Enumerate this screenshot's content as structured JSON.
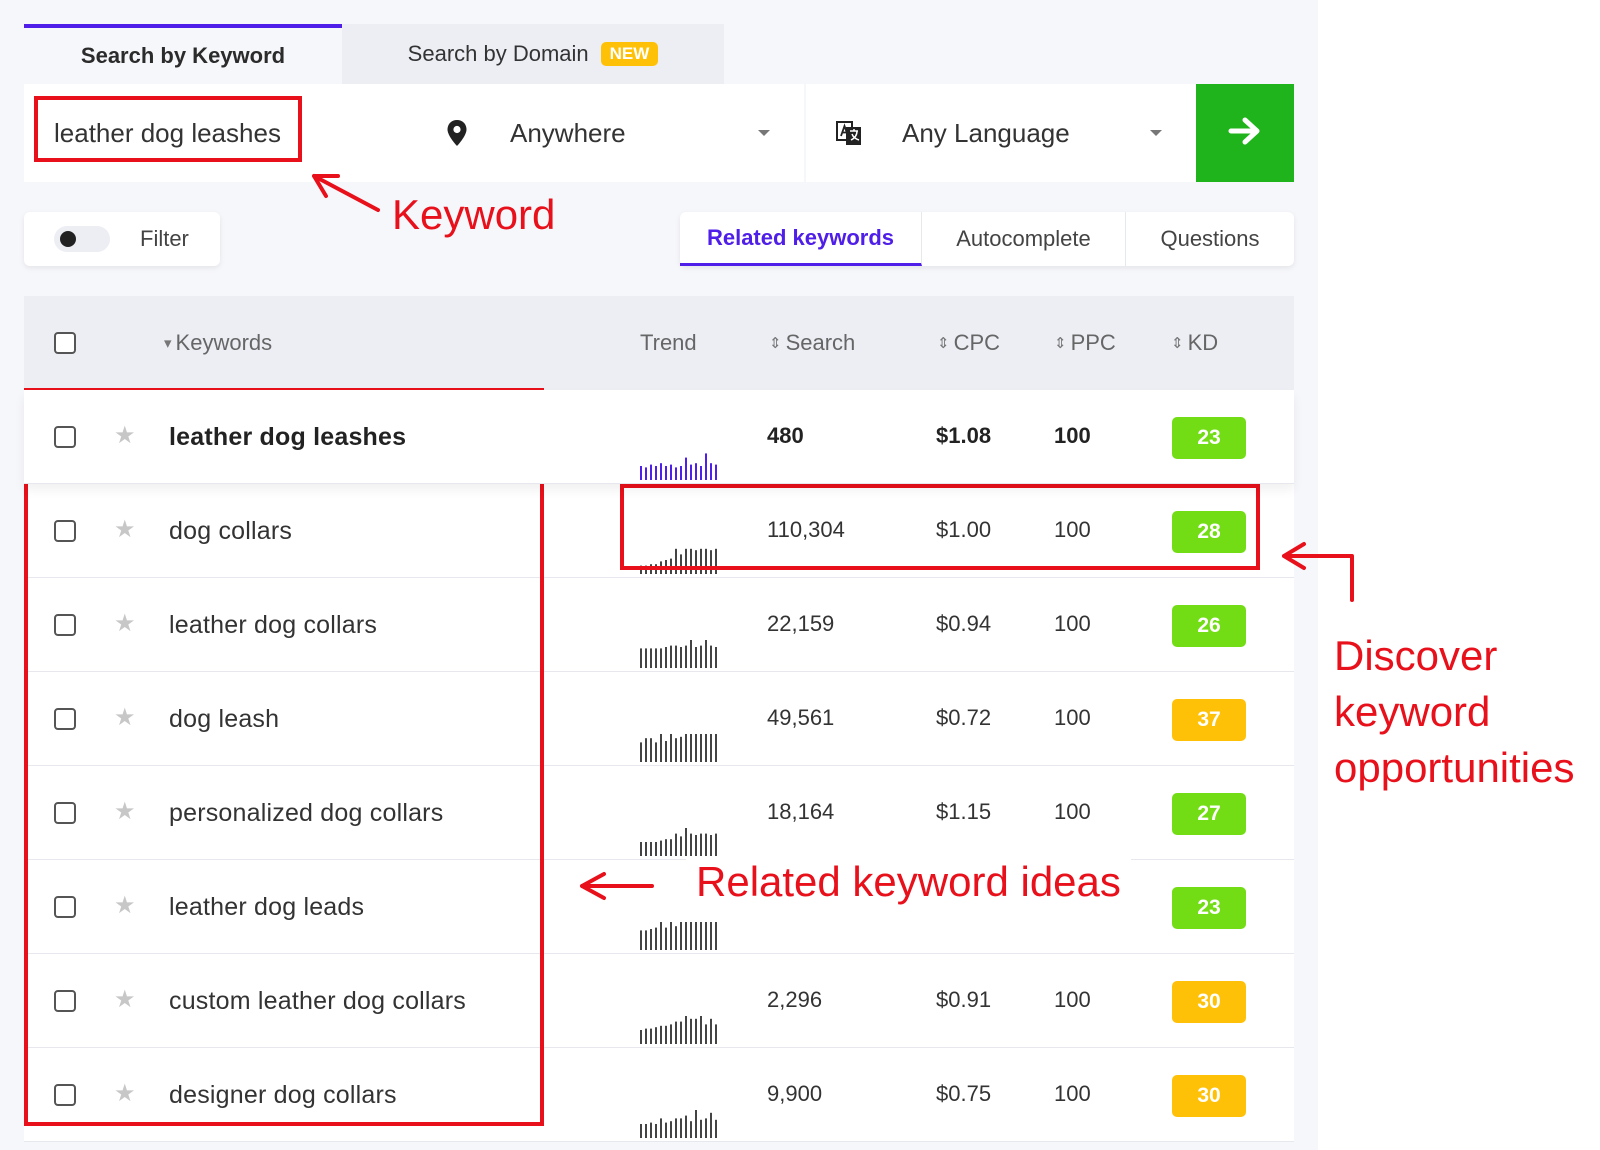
{
  "tabs": {
    "keyword": "Search by Keyword",
    "domain": "Search by Domain",
    "new_badge": "NEW"
  },
  "search": {
    "keyword_value": "leather dog leashes",
    "location": "Anywhere",
    "language": "Any Language"
  },
  "filter": {
    "label": "Filter"
  },
  "subtabs": [
    "Related keywords",
    "Autocomplete",
    "Questions"
  ],
  "columns": {
    "keywords": "Keywords",
    "trend": "Trend",
    "search": "Search",
    "cpc": "CPC",
    "ppc": "PPC",
    "kd": "KD"
  },
  "rows": [
    {
      "keyword": "leather dog leashes",
      "search": "480",
      "cpc": "$1.08",
      "ppc": "100",
      "kd": "23",
      "kd_color": "#72dd14",
      "trend_color": "#4f1ee8",
      "trend": [
        0.5,
        0.45,
        0.55,
        0.5,
        0.6,
        0.5,
        0.55,
        0.45,
        0.5,
        0.8,
        0.55,
        0.6,
        0.5,
        0.95,
        0.6,
        0.55
      ]
    },
    {
      "keyword": "dog collars",
      "search": "110,304",
      "cpc": "$1.00",
      "ppc": "100",
      "kd": "28",
      "kd_color": "#72dd14",
      "trend_color": "#444444",
      "trend": [
        0.3,
        0.3,
        0.35,
        0.35,
        0.45,
        0.5,
        0.55,
        0.9,
        0.7,
        0.9,
        0.9,
        0.85,
        0.9,
        0.9,
        0.85,
        0.9
      ]
    },
    {
      "keyword": "leather dog collars",
      "search": "22,159",
      "cpc": "$0.94",
      "ppc": "100",
      "kd": "26",
      "kd_color": "#72dd14",
      "trend_color": "#444444",
      "trend": [
        0.7,
        0.7,
        0.7,
        0.7,
        0.7,
        0.75,
        0.8,
        0.8,
        0.75,
        0.8,
        1.0,
        0.75,
        0.8,
        1.0,
        0.8,
        0.75
      ]
    },
    {
      "keyword": "dog leash",
      "search": "49,561",
      "cpc": "$0.72",
      "ppc": "100",
      "kd": "37",
      "kd_color": "#ffc107",
      "trend_color": "#444444",
      "trend": [
        0.7,
        0.85,
        0.85,
        0.7,
        1.0,
        0.75,
        1.0,
        0.85,
        0.9,
        1.0,
        1.0,
        1.0,
        1.0,
        1.0,
        1.0,
        1.0
      ]
    },
    {
      "keyword": "personalized dog collars",
      "search": "18,164",
      "cpc": "$1.15",
      "ppc": "100",
      "kd": "27",
      "kd_color": "#72dd14",
      "trend_color": "#444444",
      "trend": [
        0.5,
        0.5,
        0.5,
        0.5,
        0.55,
        0.6,
        0.6,
        0.8,
        0.7,
        1.0,
        0.8,
        0.75,
        0.8,
        0.8,
        0.75,
        0.8
      ]
    },
    {
      "keyword": "leather dog leads",
      "search": "",
      "cpc": "",
      "ppc": "",
      "kd": "23",
      "kd_color": "#72dd14",
      "trend_color": "#444444",
      "trend": [
        0.7,
        0.7,
        0.75,
        0.8,
        1.0,
        0.8,
        1.0,
        0.85,
        1.0,
        1.0,
        1.0,
        1.0,
        1.0,
        1.0,
        1.0,
        1.0
      ]
    },
    {
      "keyword": "custom leather dog collars",
      "search": "2,296",
      "cpc": "$0.91",
      "ppc": "100",
      "kd": "30",
      "kd_color": "#ffc107",
      "trend_color": "#444444",
      "trend": [
        0.5,
        0.55,
        0.55,
        0.6,
        0.65,
        0.65,
        0.7,
        0.8,
        0.8,
        1.0,
        0.9,
        0.9,
        1.0,
        0.7,
        0.9,
        0.7
      ]
    },
    {
      "keyword": "designer dog collars",
      "search": "9,900",
      "cpc": "$0.75",
      "ppc": "100",
      "kd": "30",
      "kd_color": "#ffc107",
      "trend_color": "#444444",
      "trend": [
        0.5,
        0.5,
        0.55,
        0.5,
        0.7,
        0.55,
        0.6,
        0.7,
        0.7,
        0.8,
        0.6,
        1.0,
        0.65,
        0.7,
        0.9,
        0.65
      ]
    }
  ],
  "annotations": {
    "keyword": "Keyword",
    "discover_line1": "Discover",
    "discover_line2": "keyword",
    "discover_line3": "opportunities",
    "related": "Related keyword ideas",
    "color": "#e8101a"
  },
  "icons": {
    "location": "map-pin-icon",
    "language": "translate-icon",
    "go": "arrow-right-icon",
    "star": "star-icon",
    "sort": "sort-icon"
  }
}
